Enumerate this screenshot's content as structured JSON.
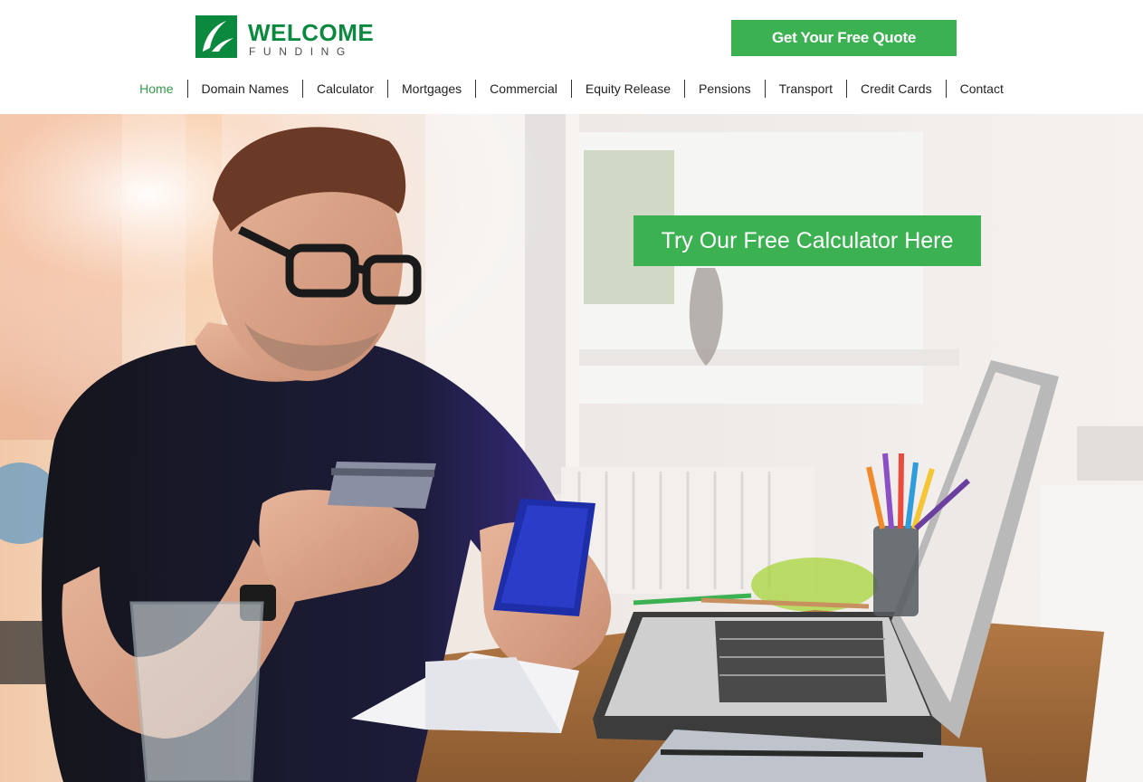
{
  "brand": {
    "name": "WELCOME",
    "tagline": "FUNDING",
    "color": "#0b8a3f"
  },
  "header": {
    "quote_button": "Get Your Free Quote"
  },
  "nav": {
    "active": "Home",
    "items": [
      {
        "label": "Home"
      },
      {
        "label": "Domain Names"
      },
      {
        "label": "Calculator"
      },
      {
        "label": "Mortgages"
      },
      {
        "label": "Commercial"
      },
      {
        "label": "Equity Release"
      },
      {
        "label": "Pensions"
      },
      {
        "label": "Transport"
      },
      {
        "label": "Credit Cards"
      },
      {
        "label": "Contact"
      }
    ]
  },
  "hero": {
    "image": "man-with-credit-card-and-phone-at-laptop",
    "cta_button": "Try Our Free Calculator Here"
  },
  "colors": {
    "accent": "#3cb152",
    "nav_active": "#2f9c48",
    "text": "#222222"
  }
}
